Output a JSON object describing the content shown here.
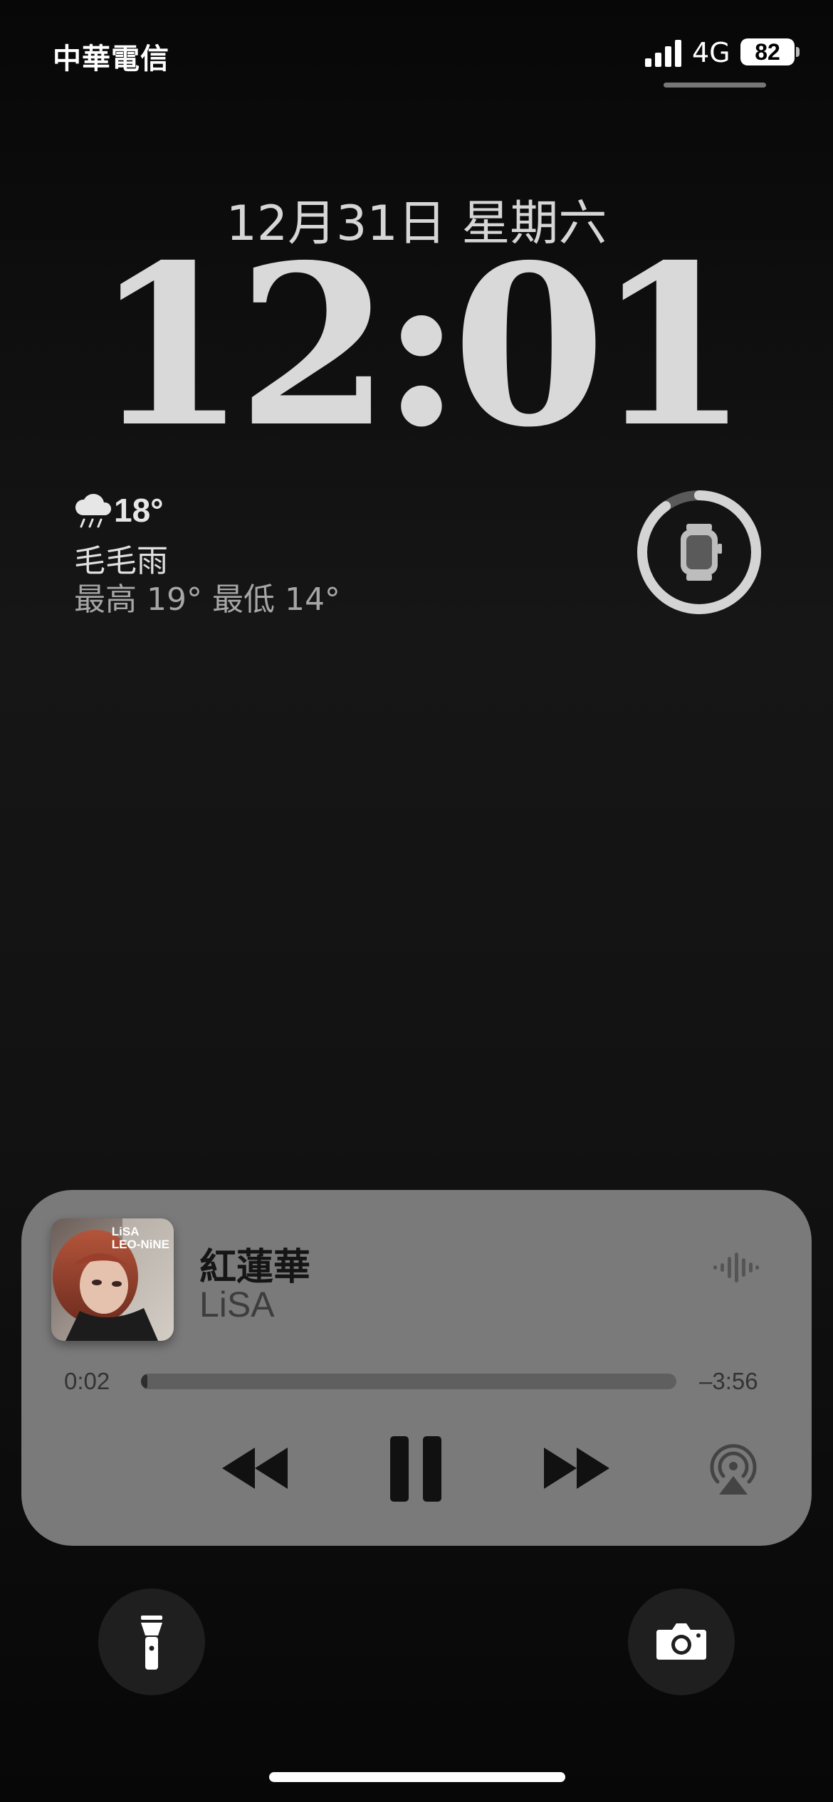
{
  "status_bar": {
    "carrier": "中華電信",
    "network": "4G",
    "battery_level": "82"
  },
  "lock_screen": {
    "date": "12月31日 星期六",
    "time": "12:01"
  },
  "weather": {
    "icon": "rain-cloud-icon",
    "temperature": "18°",
    "condition": "毛毛雨",
    "range": "最高 19° 最低 14°"
  },
  "watch_widget": {
    "icon": "apple-watch-icon",
    "ring_level": 0.9
  },
  "now_playing": {
    "album_art_text": "LiSA\nLEO-NiNE",
    "title": "紅蓮華",
    "artist": "LiSA",
    "elapsed": "0:02",
    "remaining": "–3:56",
    "progress": 0.008,
    "controls": {
      "rewind_icon": "rewind-icon",
      "pause_icon": "pause-icon",
      "forward_icon": "fast-forward-icon",
      "airplay_icon": "airplay-audio-icon",
      "waveform_icon": "waveform-icon"
    },
    "colors": {
      "card": "#7a7a7a",
      "title": "#151515",
      "artist": "#3d3d3d"
    }
  },
  "quick_actions": {
    "flashlight_icon": "flashlight-icon",
    "camera_icon": "camera-icon"
  }
}
